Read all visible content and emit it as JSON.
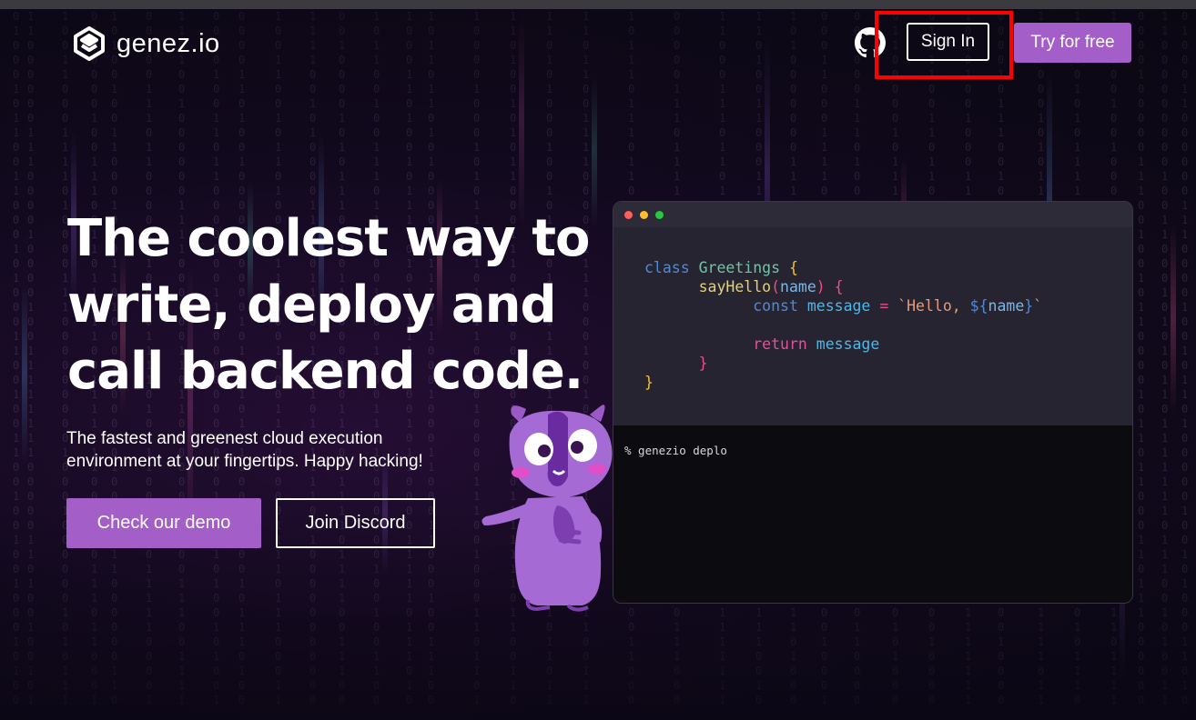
{
  "header": {
    "logo_text": "genez.io",
    "github_icon": "github-icon",
    "sign_in_label": "Sign In",
    "try_free_label": "Try for free"
  },
  "hero": {
    "title_lines": [
      "The coolest way to",
      "write, deploy and",
      "call backend code."
    ],
    "subtitle_lines": [
      "The fastest and greenest cloud execution",
      "environment at your fingertips. Happy hacking!"
    ],
    "demo_button": "Check our demo",
    "discord_button": "Join Discord"
  },
  "editor": {
    "code_lines": [
      "class Greetings {",
      "      sayHello(name) {",
      "            const message = `Hello, ${name}`",
      "",
      "            return message",
      "      }",
      "}"
    ],
    "terminal_text": "% genezio deplo"
  },
  "colors": {
    "accent": "#a35fc7",
    "highlight_box": "#ff0000",
    "background": "#140a22"
  }
}
